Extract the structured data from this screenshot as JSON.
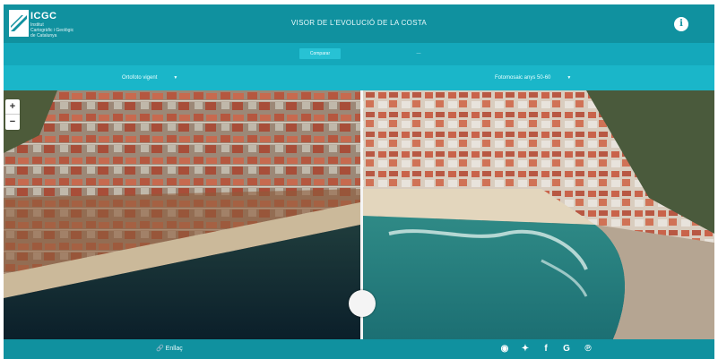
{
  "header": {
    "logo_brand": "ICGC",
    "logo_subtitle_1": "Institut",
    "logo_subtitle_2": "Cartogràfic i Geològic",
    "logo_subtitle_3": "de Catalunya",
    "title": "VISOR DE L'EVOLUCIÓ DE LA COSTA",
    "info_label": "i"
  },
  "tabs": [
    {
      "label": "Comparar"
    },
    {
      "label": "—"
    }
  ],
  "selectors": {
    "left": {
      "value": "Ortofoto vigent"
    },
    "right": {
      "value": "Fotomosaic anys 50-60"
    }
  },
  "map": {
    "zoom_in": "+",
    "zoom_out": "−",
    "swipe_position": 0.5
  },
  "footer": {
    "share_label": "Enllaç",
    "social_icons": [
      "globe-icon",
      "twitter-icon",
      "facebook-icon",
      "google-icon",
      "pinterest-icon"
    ]
  },
  "colors": {
    "header": "#10919f",
    "tabs": "#14a8bb",
    "selectors": "#1ab6c9"
  }
}
